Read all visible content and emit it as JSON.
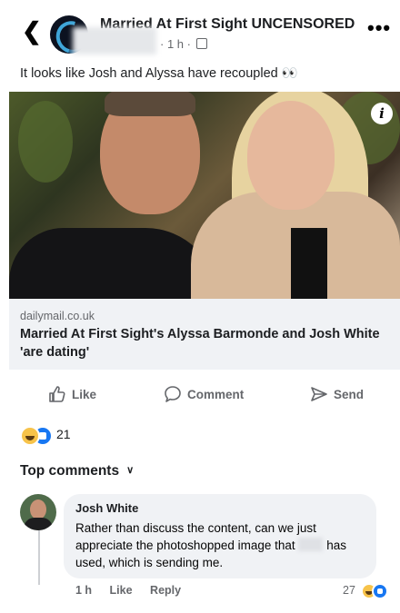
{
  "header": {
    "back_icon": "chevron-left-icon",
    "page_name": "Married At First Sight UNCENSORED",
    "time": "1 h",
    "audience_icon": "globe-icon",
    "more_icon": "more-horizontal-icon"
  },
  "post": {
    "text": "It looks like Josh and Alyssa have recoupled 👀",
    "info_icon": "info-icon",
    "link": {
      "domain": "dailymail.co.uk",
      "title": "Married At First Sight's Alyssa Barmonde and Josh White 'are dating'"
    }
  },
  "actions": {
    "like": "Like",
    "comment": "Comment",
    "send": "Send"
  },
  "reactions": {
    "types": [
      "haha",
      "like"
    ],
    "count": "21"
  },
  "comments": {
    "header": "Top comments",
    "items": [
      {
        "author": "Josh White",
        "text_before": "Rather than discuss the content, can we just appreciate the photoshopped image that",
        "text_after": "has used, which is sending me.",
        "time": "1 h",
        "like_label": "Like",
        "reply_label": "Reply",
        "reaction_count": "27"
      }
    ]
  },
  "colors": {
    "accent": "#1877f2",
    "muted": "#65676b",
    "bubble": "#f0f2f5"
  }
}
